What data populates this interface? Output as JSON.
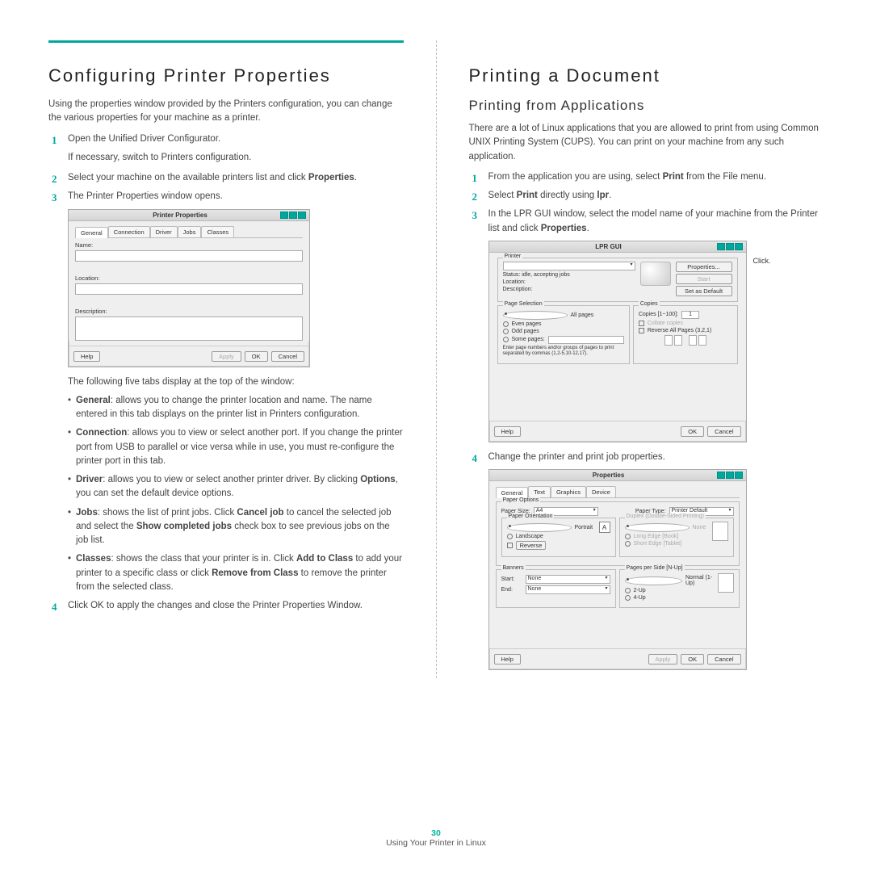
{
  "left": {
    "h1": "Configuring Printer Properties",
    "intro": "Using the properties window provided by the Printers configuration, you can change the various properties for your machine as a printer.",
    "steps": {
      "s1": "Open the Unified Driver Configurator.",
      "s1_sub": "If necessary, switch to Printers configuration.",
      "s2a": "Select your machine on the available printers list and click ",
      "s2b": "Properties",
      "s2c": ".",
      "s3": "The Printer Properties window opens.",
      "s4": "Click OK to apply the changes and close the Printer Properties Window."
    },
    "tabs_intro": "The following five tabs display at the top of the window:",
    "tabs": {
      "general_b": "General",
      "general": ": allows you to change the printer location and name. The name entered in this tab displays on the printer list in Printers configuration.",
      "connection_b": "Connection",
      "connection": ": allows you to view or select another port. If you change the printer port from USB to parallel or vice versa while in use, you must re-configure the printer port in this tab.",
      "driver_b": "Driver",
      "driver_a": ": allows you to view or select another printer driver. By clicking ",
      "driver_opt": "Options",
      "driver_c": ", you can set the default device options.",
      "jobs_b": "Jobs",
      "jobs_a": ": shows the list of print jobs. Click ",
      "jobs_cancel": "Cancel job",
      "jobs_b2": " to cancel the selected job and select the ",
      "jobs_show": "Show completed jobs",
      "jobs_c": " check box to see previous jobs on the job list.",
      "classes_b": "Classes",
      "classes_a": ": shows the class that your printer is in. Click ",
      "classes_add": "Add to Class",
      "classes_b2": " to add your printer to a specific class or click ",
      "classes_rem": "Remove from Class",
      "classes_c": " to remove the printer from the selected class."
    },
    "win": {
      "title": "Printer Properties",
      "tab_general": "General",
      "tab_connection": "Connection",
      "tab_driver": "Driver",
      "tab_jobs": "Jobs",
      "tab_classes": "Classes",
      "lbl_name": "Name:",
      "lbl_location": "Location:",
      "lbl_description": "Description:",
      "help": "Help",
      "apply": "Apply",
      "ok": "OK",
      "cancel": "Cancel"
    }
  },
  "right": {
    "h1": "Printing a Document",
    "h2": "Printing from Applications",
    "intro": "There are a lot of Linux applications that you are allowed to print from using Common UNIX Printing System (CUPS). You can print on your machine from any such application.",
    "steps": {
      "s1a": "From the application you are using, select ",
      "s1b": "Print",
      "s1c": " from the File menu.",
      "s2a": "Select ",
      "s2b": "Print",
      "s2c": " directly using ",
      "s2d": "lpr",
      "s2e": ".",
      "s3a": "In the LPR GUI window, select the model name of your machine from the Printer list and click ",
      "s3b": "Properties",
      "s3c": ".",
      "s4": "Change the printer and print job properties."
    },
    "callout": "Click.",
    "lpr": {
      "title": "LPR GUI",
      "grp_printer": "Printer",
      "status": "Status: idle, accepting jobs",
      "location": "Location:",
      "desc": "Description:",
      "properties": "Properties...",
      "start": "Start",
      "setdefault": "Set as Default",
      "grp_pagesel": "Page Selection",
      "all": "All pages",
      "even": "Even pages",
      "odd": "Odd pages",
      "some": "Some pages:",
      "hint": "Enter page numbers and/or groups of pages to print separated by commas (1,2-5,10-12,17).",
      "grp_copies": "Copies",
      "copies_lbl": "Copies [1~100]:",
      "copies_val": "1",
      "collate": "Collate copies",
      "reverse": "Reverse All Pages (3,2,1)",
      "help": "Help",
      "ok": "OK",
      "cancel": "Cancel"
    },
    "props": {
      "title": "Properties",
      "tab_general": "General",
      "tab_text": "Text",
      "tab_graphics": "Graphics",
      "tab_device": "Device",
      "grp_paper": "Paper Options",
      "paper_size": "Paper Size:",
      "a4": "A4",
      "paper_type": "Paper Type:",
      "printer_default": "Printer Default",
      "grp_orient": "Paper Orientation",
      "portrait": "Portrait",
      "landscape": "Landscape",
      "reverse": "Reverse",
      "grp_duplex": "Duplex (Double-Sided Printing)",
      "none": "None",
      "long": "Long Edge [Book]",
      "short": "Short Edge [Tablet]",
      "grp_banners": "Banners",
      "start": "Start:",
      "end": "End:",
      "noneval": "None",
      "grp_pps": "Pages per Side [N-Up]",
      "normal": "Normal (1-Up)",
      "two": "2-Up",
      "four": "4-Up",
      "help": "Help",
      "apply": "Apply",
      "ok": "OK",
      "cancel": "Cancel"
    }
  },
  "footer": {
    "page": "30",
    "caption": "Using Your Printer in Linux"
  }
}
